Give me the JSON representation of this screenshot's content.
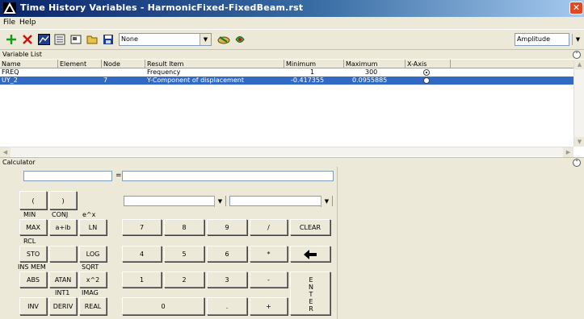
{
  "window": {
    "title": "Time History Variables - HarmonicFixed-FixedBeam.rst",
    "close_glyph": "✕"
  },
  "menu": [
    "File",
    "Help"
  ],
  "toolbar": {
    "filter_combo": "None",
    "display_combo": "Amplitude",
    "icons": [
      "add-variable-icon",
      "delete-variable-icon",
      "graph-icon",
      "list-icon",
      "properties-icon",
      "open-icon",
      "save-icon",
      "import-icon",
      "export-icon"
    ]
  },
  "variable_list": {
    "title": "Variable List",
    "columns": [
      "Name",
      "Element",
      "Node",
      "Result Item",
      "Minimum",
      "Maximum",
      "X-Axis"
    ],
    "rows": [
      {
        "name": "FREQ",
        "element": "",
        "node": "",
        "result_item": "Frequency",
        "minimum": "1",
        "maximum": "300",
        "x_axis": true,
        "selected": false
      },
      {
        "name": "UY_2",
        "element": "",
        "node": "7",
        "result_item": "Y-Component of displacement",
        "minimum": "-0.417355",
        "maximum": "0.0955885",
        "x_axis": false,
        "selected": true
      }
    ]
  },
  "calculator": {
    "title": "Calculator",
    "equals": "=",
    "labels": {
      "min": "MIN",
      "conj": "CONJ",
      "epowx": "e^x",
      "rcl": "RCL",
      "ins_mem": "INS MEM",
      "sqrt": "SQRT",
      "int1": "INT1",
      "imag": "IMAG"
    },
    "buttons": {
      "lparen": "(",
      "rparen": ")",
      "max": "MAX",
      "aib": "a+ib",
      "ln": "LN",
      "seven": "7",
      "eight": "8",
      "nine": "9",
      "divide": "/",
      "clear": "CLEAR",
      "sto": "STO",
      "log": "LOG",
      "four": "4",
      "five": "5",
      "six": "6",
      "multiply": "*",
      "abs": "ABS",
      "atan": "ATAN",
      "xsq": "x^2",
      "one": "1",
      "two": "2",
      "three": "3",
      "minus": "-",
      "inv": "INV",
      "deriv": "DERIV",
      "real": "REAL",
      "zero": "0",
      "dot": ".",
      "plus": "+",
      "enter": [
        "E",
        "N",
        "T",
        "E",
        "R"
      ]
    }
  }
}
